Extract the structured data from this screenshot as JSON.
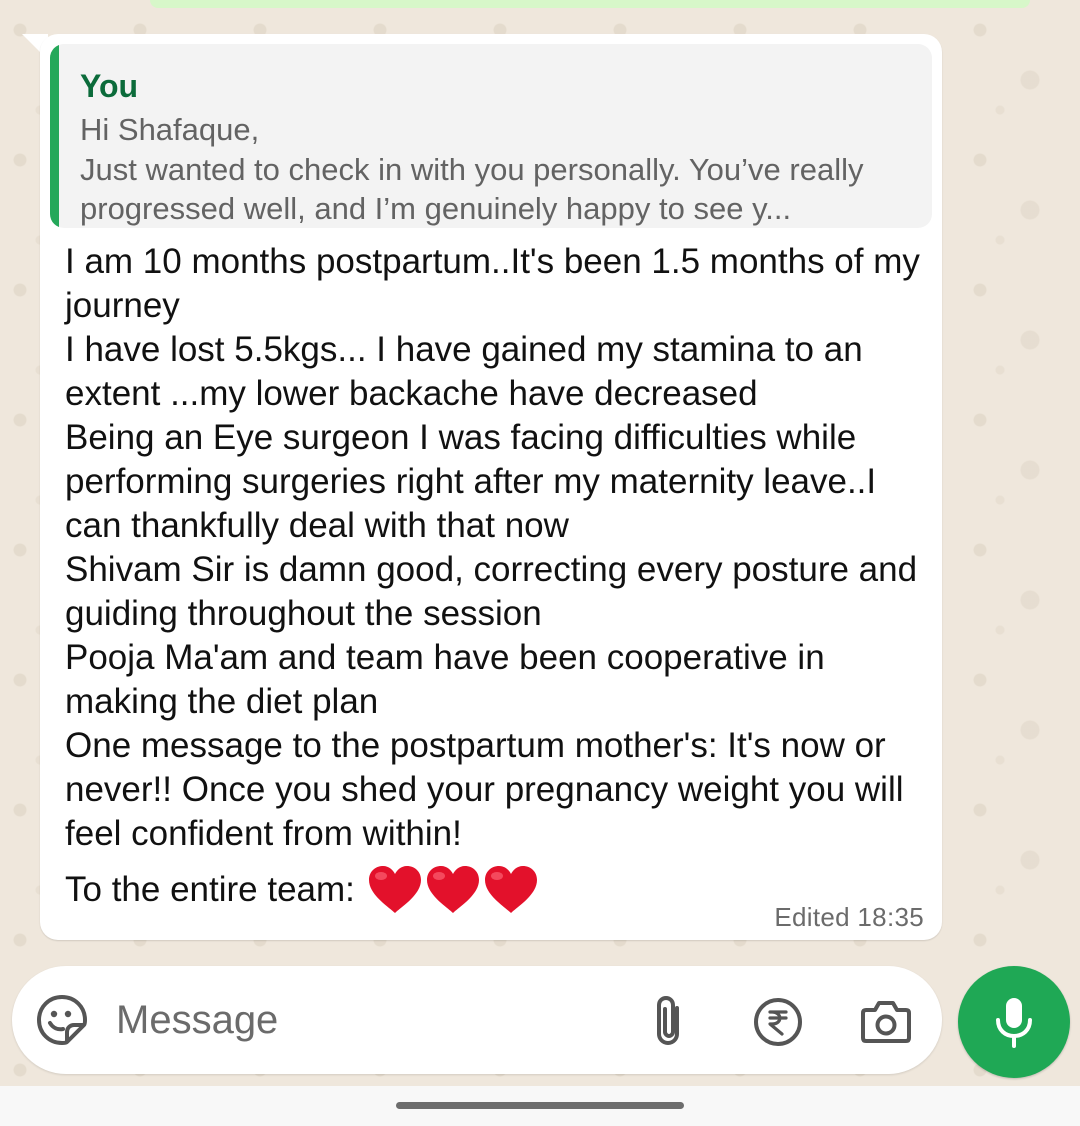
{
  "quoted_message": {
    "author": "You",
    "text": "Hi Shafaque,\nJust wanted to check in with you personally. You’ve really progressed well, and I’m genuinely happy to see y..."
  },
  "message": {
    "text": "I am 10 months postpartum..It's been 1.5 months of my journey\nI have lost 5.5kgs... I have gained my stamina to an extent ...my lower backache have decreased\nBeing an Eye surgeon I was facing difficulties while performing surgeries right after my maternity leave..I can thankfully deal with that now\nShivam Sir is damn good, correcting every posture and guiding throughout the session\nPooja Ma'am and team have been cooperative in making the diet plan\nOne message to the postpartum mother's: It's now or never!! Once you shed your pregnancy weight you will feel confident from within!",
    "closing_text": "To the entire team:",
    "emoji_count": 3,
    "edited_label": "Edited",
    "time": "18:35"
  },
  "composer": {
    "placeholder": "Message",
    "icons": [
      "sticker-icon",
      "attach-icon",
      "rupee-icon",
      "camera-icon",
      "mic-icon"
    ]
  },
  "colors": {
    "quote_bar": "#25a85a",
    "quote_author": "#0b6b3a",
    "mic_button": "#1fa855",
    "heart": "#e3112b",
    "chat_background": "#efe7dc"
  }
}
